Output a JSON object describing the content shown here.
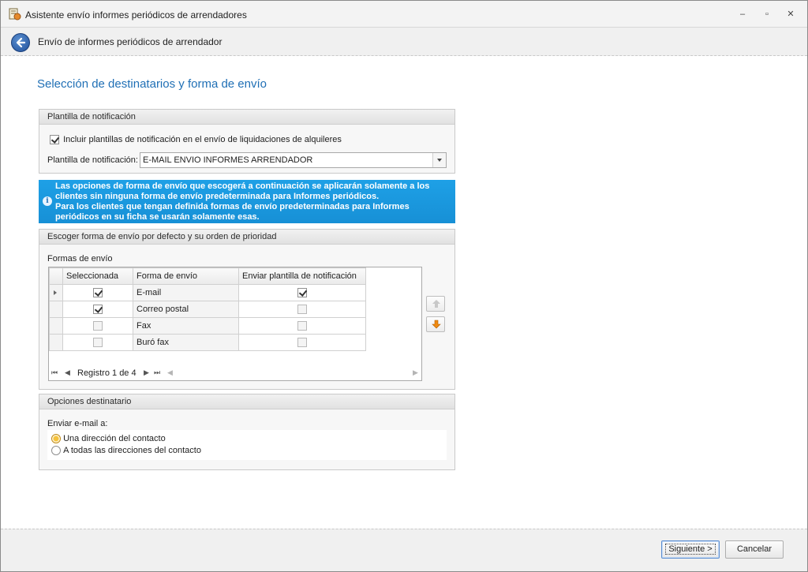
{
  "window": {
    "title": "Asistente envío informes periódicos de arrendadores",
    "controls": {
      "minimize": "–",
      "restore": "▫",
      "close": "✕"
    }
  },
  "header": {
    "title": "Envío de informes periódicos de arrendador",
    "back_icon": "back-arrow-icon"
  },
  "page": {
    "title": "Selección de destinatarios y forma de envío"
  },
  "template_group": {
    "header": "Plantilla de notificación",
    "include_checkbox_label": "Incluir plantillas de notificación en el envío de liquidaciones de alquileres",
    "include_checked": true,
    "template_label": "Plantilla de notificación:",
    "template_value": "E-MAIL ENVIO INFORMES ARRENDADOR"
  },
  "info": {
    "lines": [
      "Las opciones de forma de envío que escogerá a continuación se aplicarán solamente a los",
      "clientes sin ninguna forma de envío predeterminada para Informes periódicos.",
      "Para los clientes que tengan definida formas de envío predeterminadas para Informes",
      "periódicos en su ficha se usarán solamente esas."
    ]
  },
  "methods_group": {
    "header": "Escoger forma de envío por defecto y su orden de prioridad",
    "grid_label": "Formas de envío",
    "columns": [
      "Seleccionada",
      "Forma de envío",
      "Enviar plantilla de notificación"
    ],
    "rows": [
      {
        "name": "E-mail",
        "selected": true,
        "send_template": true
      },
      {
        "name": "Correo postal",
        "selected": true,
        "send_template": false
      },
      {
        "name": "Fax",
        "selected": false,
        "send_template": false
      },
      {
        "name": "Buró fax",
        "selected": false,
        "send_template": false
      }
    ],
    "navigator": {
      "record_text": "Registro 1 de 4",
      "first": "⏮",
      "prev": "◀",
      "next": "▶",
      "last": "⏭"
    }
  },
  "recipient_group": {
    "header": "Opciones destinatario",
    "send_label": "Enviar e-mail a:",
    "options": [
      "Una dirección del contacto",
      "A todas las direcciones del contacto"
    ],
    "selected_index": 0
  },
  "footer": {
    "next_label": "Siguiente >",
    "cancel_label": "Cancelar"
  },
  "colors": {
    "accent": "#1f6fb5",
    "info_bg": "#1a96dc"
  }
}
